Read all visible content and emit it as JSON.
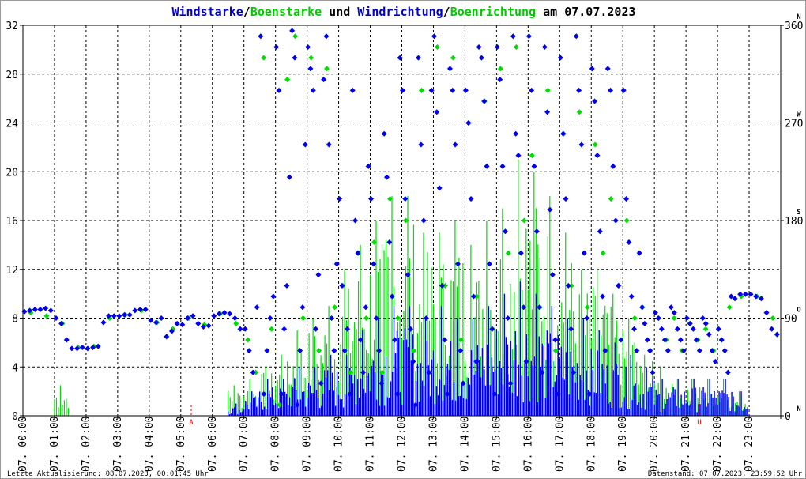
{
  "title": {
    "parts": [
      {
        "text": "Windstarke",
        "color": "#0000cc"
      },
      {
        "text": "/",
        "color": "#000000"
      },
      {
        "text": "Boenstarke",
        "color": "#00cc00"
      },
      {
        "text": " und ",
        "color": "#000000"
      },
      {
        "text": "Windrichtung",
        "color": "#0000cc"
      },
      {
        "text": "/",
        "color": "#000000"
      },
      {
        "text": "Boenrichtung",
        "color": "#00cc00"
      },
      {
        "text": " am 07.07.2023",
        "color": "#000000"
      }
    ]
  },
  "footer": {
    "left": "Letzte Aktualisierung: 08.07.2023, 00:01:45 Uhr",
    "right": "Datenstand: 07.07.2023, 23:59:52 Uhr"
  },
  "chart_data": {
    "type": "bar",
    "title": "Windstarke/Boenstarke und Windrichtung/Boenrichtung am 07.07.2023",
    "ylim": [
      0,
      32
    ],
    "y_ticks": [
      "0",
      "4",
      "8",
      "12",
      "16",
      "20",
      "24",
      "28",
      "32"
    ],
    "y2lim": [
      0,
      360
    ],
    "y2_ticks": [
      "0",
      "90",
      "180",
      "270",
      "360"
    ],
    "y2_compass": [
      "N",
      "O",
      "S",
      "W",
      "N"
    ],
    "x_ticks": [
      "07. 00:00",
      "07. 01:00",
      "07. 02:00",
      "07. 03:00",
      "07. 04:00",
      "07. 05:00",
      "07. 06:00",
      "07. 07:00",
      "07. 08:00",
      "07. 09:00",
      "07. 10:00",
      "07. 11:00",
      "07. 12:00",
      "07. 13:00",
      "07. 14:00",
      "07. 15:00",
      "07. 16:00",
      "07. 17:00",
      "07. 18:00",
      "07. 19:00",
      "07. 20:00",
      "07. 21:00",
      "07. 22:00",
      "07. 23:00"
    ],
    "markers": [
      {
        "label": "A",
        "hour": 5.33,
        "color": "#ff0000"
      },
      {
        "label": "U",
        "hour": 21.42,
        "color": "#ff0000"
      }
    ],
    "interval_hours": 0.5,
    "wind_speed_max": [
      0,
      0,
      0,
      0,
      0,
      0,
      0,
      0,
      0,
      0,
      0,
      0,
      0,
      1,
      2,
      3,
      3,
      4,
      4,
      5,
      5,
      7,
      8,
      9,
      9,
      8,
      9,
      8,
      8,
      9,
      10,
      11,
      10,
      9,
      8,
      8,
      7,
      6,
      5,
      4,
      3,
      3,
      3,
      3,
      3,
      2,
      0,
      0
    ],
    "gust_max": [
      0,
      0,
      2.5,
      0,
      0,
      0,
      0,
      0,
      0,
      0,
      0,
      0,
      0,
      2.5,
      3,
      4,
      5,
      7,
      8,
      9,
      12,
      14,
      16,
      18,
      18,
      15,
      15,
      16,
      14,
      16,
      17,
      21,
      20,
      18,
      15,
      12,
      12,
      10,
      8,
      5,
      4,
      3,
      3,
      3,
      3,
      2,
      0,
      0
    ],
    "wind_direction_deg": [
      [
        96,
        97,
        98
      ],
      [
        98,
        99,
        97
      ],
      [
        90,
        85,
        70
      ],
      [
        62,
        62,
        63
      ],
      [
        62,
        63,
        64
      ],
      [
        86,
        92,
        92
      ],
      [
        92,
        93,
        93
      ],
      [
        97,
        98,
        98
      ],
      [
        88,
        86,
        90
      ],
      [
        73,
        78,
        85
      ],
      [
        84,
        90,
        92
      ],
      [
        85,
        82,
        83
      ],
      [
        92,
        94,
        95
      ],
      [
        94,
        90,
        80
      ],
      [
        80,
        60,
        40,
        100
      ],
      [
        350,
        20,
        60,
        90,
        110
      ],
      [
        340,
        300,
        20,
        80,
        120,
        220
      ],
      [
        355,
        330,
        10,
        60,
        100,
        250
      ],
      [
        340,
        320,
        300,
        80,
        130,
        30
      ],
      [
        310,
        350,
        250,
        90,
        60,
        140
      ],
      [
        200,
        120,
        60,
        80,
        20,
        300
      ],
      [
        180,
        150,
        70,
        40,
        100,
        230
      ],
      [
        200,
        140,
        90,
        60,
        30,
        260
      ],
      [
        220,
        160,
        110,
        70,
        20,
        330
      ],
      [
        300,
        200,
        130,
        80,
        50,
        10
      ],
      [
        330,
        250,
        180,
        90,
        40,
        300
      ],
      [
        350,
        280,
        210,
        120,
        70,
        20
      ],
      [
        320,
        300,
        250,
        140,
        60,
        30
      ],
      [
        300,
        270,
        200,
        110,
        50,
        340
      ],
      [
        330,
        290,
        230,
        140,
        80,
        20
      ],
      [
        340,
        310,
        230,
        170,
        90,
        30
      ],
      [
        350,
        260,
        240,
        150,
        100,
        50
      ],
      [
        350,
        300,
        230,
        170,
        100,
        40
      ],
      [
        340,
        280,
        190,
        130,
        70,
        20
      ],
      [
        330,
        260,
        200,
        120,
        80,
        40
      ],
      [
        350,
        300,
        250,
        150,
        90,
        20
      ],
      [
        320,
        290,
        240,
        170,
        110,
        60
      ],
      [
        320,
        300,
        230,
        180,
        120,
        70
      ],
      [
        300,
        200,
        160,
        110,
        80,
        60
      ],
      [
        150,
        100,
        85,
        70,
        60,
        40
      ],
      [
        95,
        90,
        80,
        70,
        60
      ],
      [
        100,
        95,
        80,
        70,
        60
      ],
      [
        90,
        85,
        80,
        70,
        60
      ],
      [
        90,
        85,
        75,
        60,
        50
      ],
      [
        80,
        70,
        60,
        40,
        110
      ],
      [
        108,
        112,
        112
      ],
      [
        112,
        110,
        108
      ],
      [
        95,
        80,
        75
      ]
    ],
    "gust_direction_deg": [
      [
        95
      ],
      [
        92
      ],
      [
        85
      ],
      [
        63
      ],
      [
        64
      ],
      [
        90
      ],
      [
        93
      ],
      [
        97
      ],
      [
        86
      ],
      [
        80
      ],
      [
        90
      ],
      [
        84
      ],
      [
        94
      ],
      [
        85
      ],
      [
        70,
        40
      ],
      [
        330,
        80
      ],
      [
        10,
        310
      ],
      [
        350,
        90
      ],
      [
        330,
        60
      ],
      [
        320,
        100
      ],
      [
        120,
        40
      ],
      [
        150,
        90
      ],
      [
        160,
        40
      ],
      [
        200,
        90
      ],
      [
        180,
        60
      ],
      [
        300,
        40
      ],
      [
        340,
        120
      ],
      [
        330,
        70
      ],
      [
        270,
        110
      ],
      [
        290,
        80
      ],
      [
        320,
        150
      ],
      [
        340,
        180
      ],
      [
        240,
        100
      ],
      [
        300,
        60
      ],
      [
        260,
        120
      ],
      [
        280,
        100
      ],
      [
        250,
        150
      ],
      [
        200,
        120
      ],
      [
        180,
        90
      ],
      [
        100,
        60
      ],
      [
        90,
        70
      ],
      [
        90,
        60
      ],
      [
        85,
        70
      ],
      [
        80,
        60
      ],
      [
        70,
        100
      ],
      [
        110
      ],
      [
        110
      ],
      [
        90
      ]
    ]
  }
}
